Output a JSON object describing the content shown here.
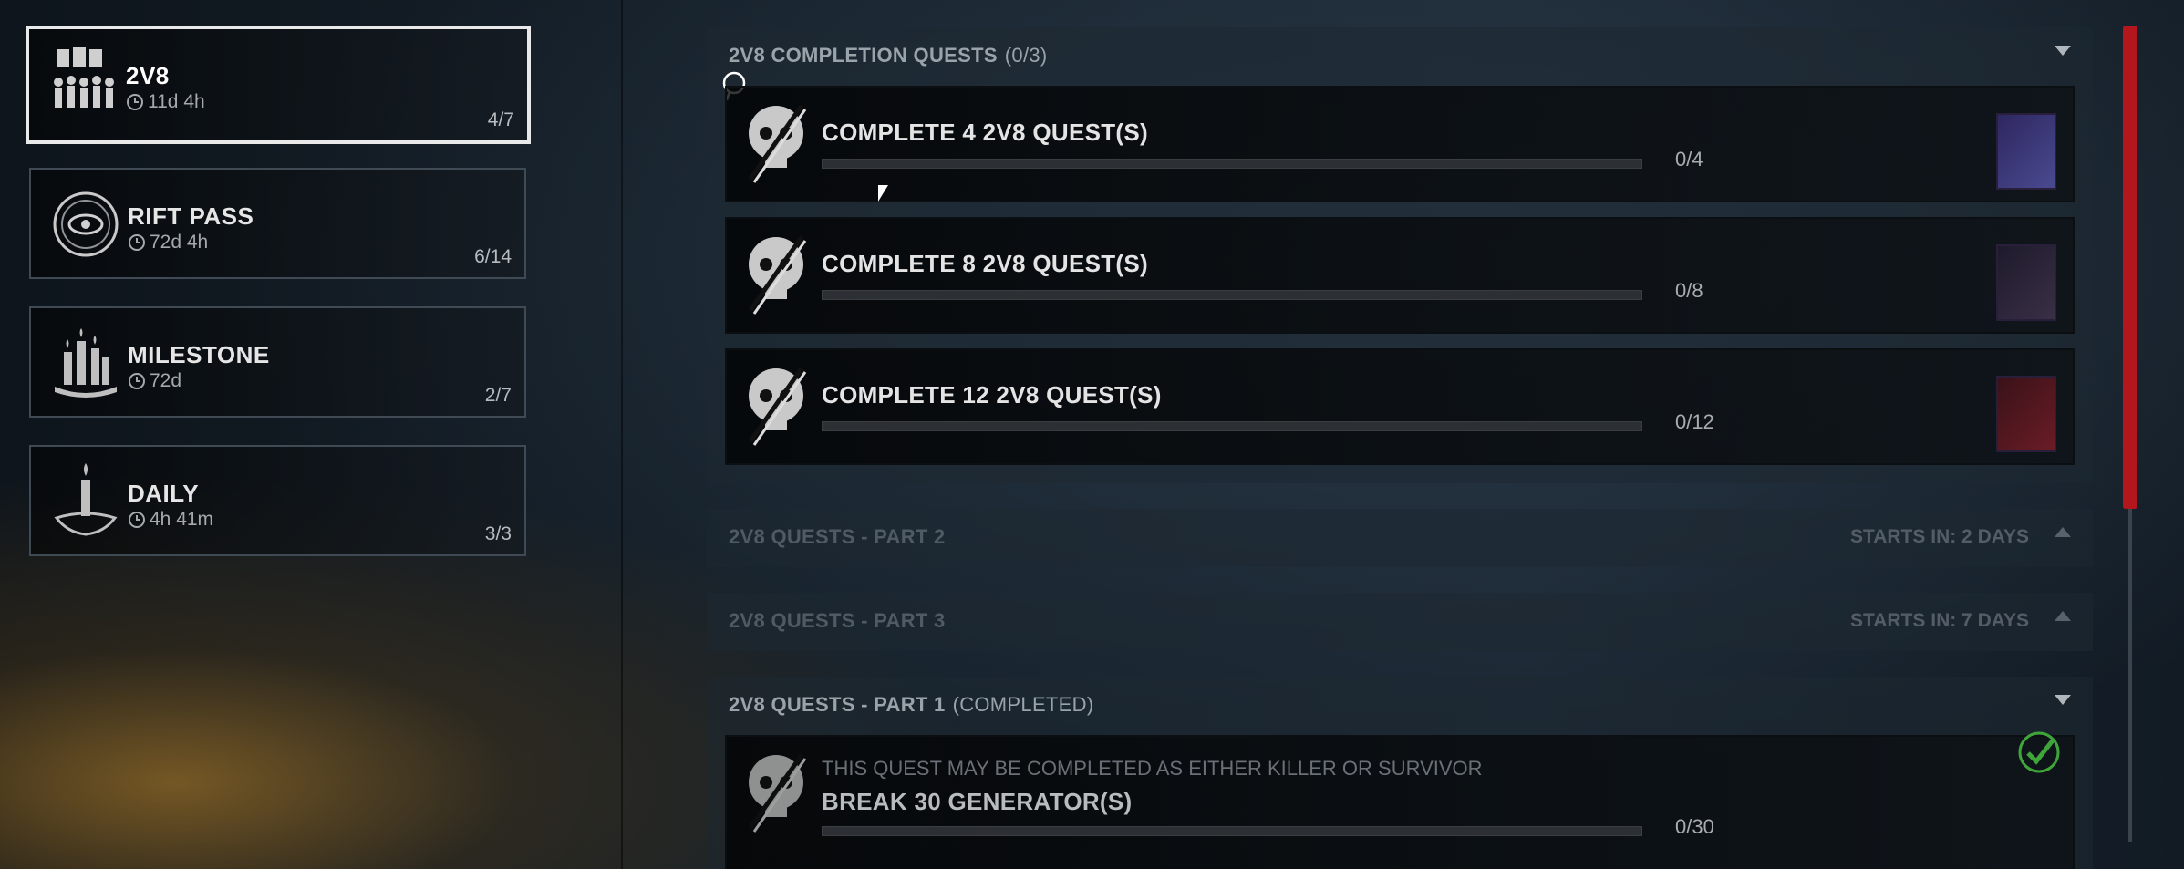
{
  "colors": {
    "selected_border": "#e9e9e9",
    "accent_scrollbar": "#b3161d",
    "check_green": "#3fa53b",
    "reward_purple": "#3b2e63"
  },
  "categories": [
    {
      "name": "2V8",
      "time": "11d 4h",
      "count": "4/7",
      "icon": "2v8-group-icon"
    },
    {
      "name": "RIFT PASS",
      "time": "72d 4h",
      "count": "6/14",
      "icon": "rift-eye-icon"
    },
    {
      "name": "MILESTONE",
      "time": "72d",
      "count": "2/7",
      "icon": "candles-icon"
    },
    {
      "name": "DAILY",
      "time": "4h 41m",
      "count": "3/3",
      "icon": "candle-hand-icon"
    }
  ],
  "sections": [
    {
      "title": "2V8 COMPLETION QUESTS",
      "subtitle": "(0/3)",
      "quests": [
        {
          "title": "COMPLETE 4 2V8 QUEST(S)",
          "progress": "0/4",
          "progress_value": 0
        },
        {
          "title": "COMPLETE 8 2V8 QUEST(S)",
          "progress": "0/8",
          "progress_value": 0
        },
        {
          "title": "COMPLETE 12 2V8 QUEST(S)",
          "progress": "0/12",
          "progress_value": 0
        }
      ]
    },
    {
      "title": "2V8 QUESTS - PART 2",
      "starts": "STARTS IN: 2 DAYS"
    },
    {
      "title": "2V8 QUESTS - PART 3",
      "starts": "STARTS IN: 7 DAYS"
    },
    {
      "title": "2V8 QUESTS - PART 1",
      "subtitle": "(COMPLETED)",
      "quests": [
        {
          "note": "THIS QUEST MAY BE COMPLETED AS EITHER KILLER OR SURVIVOR",
          "title": "BREAK 30 GENERATOR(S)",
          "progress": "0/30",
          "progress_value": 0
        }
      ]
    }
  ]
}
